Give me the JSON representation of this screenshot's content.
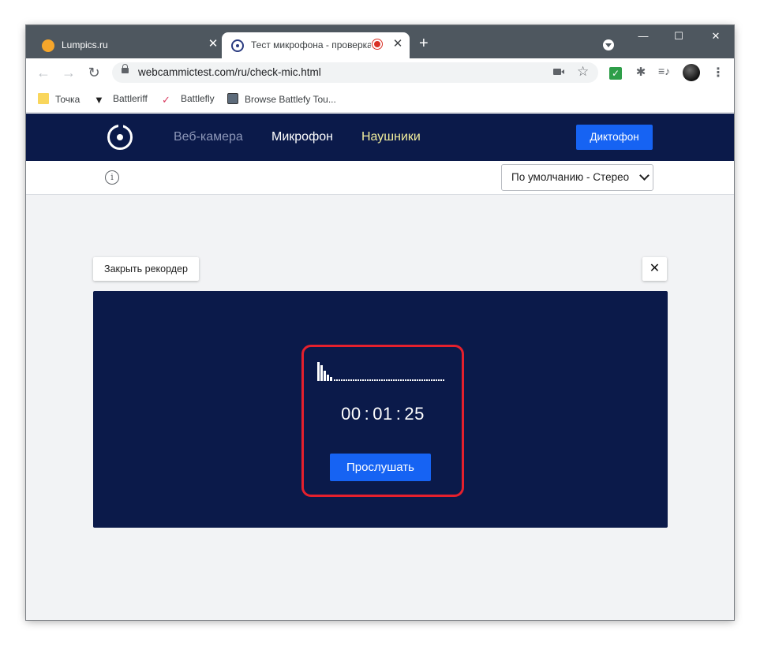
{
  "browser": {
    "tabs": [
      {
        "title": "Lumpics.ru",
        "close": "✕"
      },
      {
        "title": "Тест микрофона - проверка",
        "close": "✕"
      }
    ],
    "new_tab": "+",
    "window_controls": {
      "minimize": "—",
      "maximize": "☐",
      "close": "✕"
    },
    "url": "webcammictest.com/ru/check-mic.html",
    "bookmarks": [
      {
        "label": "Точка"
      },
      {
        "label": "Battleriff"
      },
      {
        "label": "Battlefly"
      },
      {
        "label": "Browse Battlefy Tou..."
      }
    ],
    "icons": {
      "back": "←",
      "forward": "→",
      "reload": "↻",
      "star": "☆",
      "check": "✓",
      "puzzle": "✱",
      "queue": "≡♪",
      "menu": "⋮"
    }
  },
  "site": {
    "nav": {
      "webcam": "Веб-камера",
      "mic": "Микрофон",
      "headphones": "Наушники",
      "dictaphone": "Диктофон"
    },
    "info_icon": "i",
    "device_select": {
      "value": "По умолчанию - Стерео"
    }
  },
  "recorder": {
    "close_label": "Закрыть рекордер",
    "x_label": "✕",
    "timer": {
      "hours": "00",
      "minutes": "01",
      "seconds": "25"
    },
    "listen_label": "Прослушать",
    "levels": [
      1.0,
      0.85,
      0.55,
      0.35,
      0.2
    ]
  },
  "colors": {
    "site_header": "#0b1a4a",
    "accent_blue": "#1663f3",
    "highlight_red": "#e5202d"
  }
}
